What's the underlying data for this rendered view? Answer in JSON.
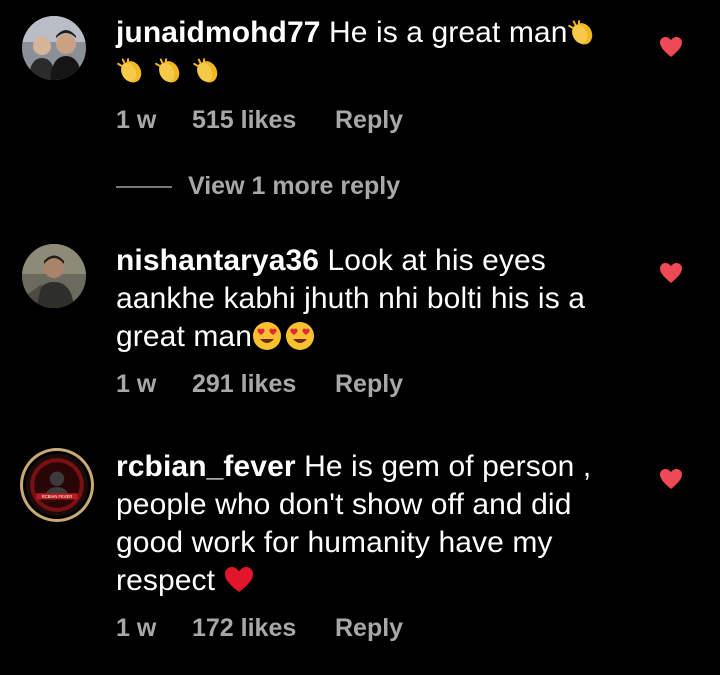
{
  "comments": [
    {
      "username": "junaidmohd77",
      "text_line1": " He is a great man",
      "time": "1 w",
      "likes": "515 likes",
      "reply": "Reply",
      "liked": true,
      "emoji": [
        "clapping-hands",
        "clapping-hands",
        "clapping-hands",
        "clapping-hands"
      ]
    },
    {
      "username": "nishantarya36",
      "text_line1": " Look at his eyes",
      "text_line2": "aankhe kabhi jhuth nhi bolti his is a",
      "text_line3": "great man",
      "time": "1 w",
      "likes": "291 likes",
      "reply": "Reply",
      "liked": true,
      "emoji": [
        "heart-eyes-face",
        "heart-eyes-face"
      ]
    },
    {
      "username": "rcbian_fever",
      "text_line1": " He is gem of person ,",
      "text_line2": "people who don't show off and did",
      "text_line3": "good work for humanity have my",
      "text_line4": "respect",
      "time": "1 w",
      "likes": "172 likes",
      "reply": "Reply",
      "liked": true,
      "emoji": [
        "red-heart"
      ],
      "avatar_text": "RCBIAN FEVER"
    }
  ],
  "view_more": "View 1 more reply",
  "colors": {
    "background": "#000000",
    "text": "#ffffff",
    "secondary": "#a8a8a8",
    "like_heart": "#ed4956"
  }
}
